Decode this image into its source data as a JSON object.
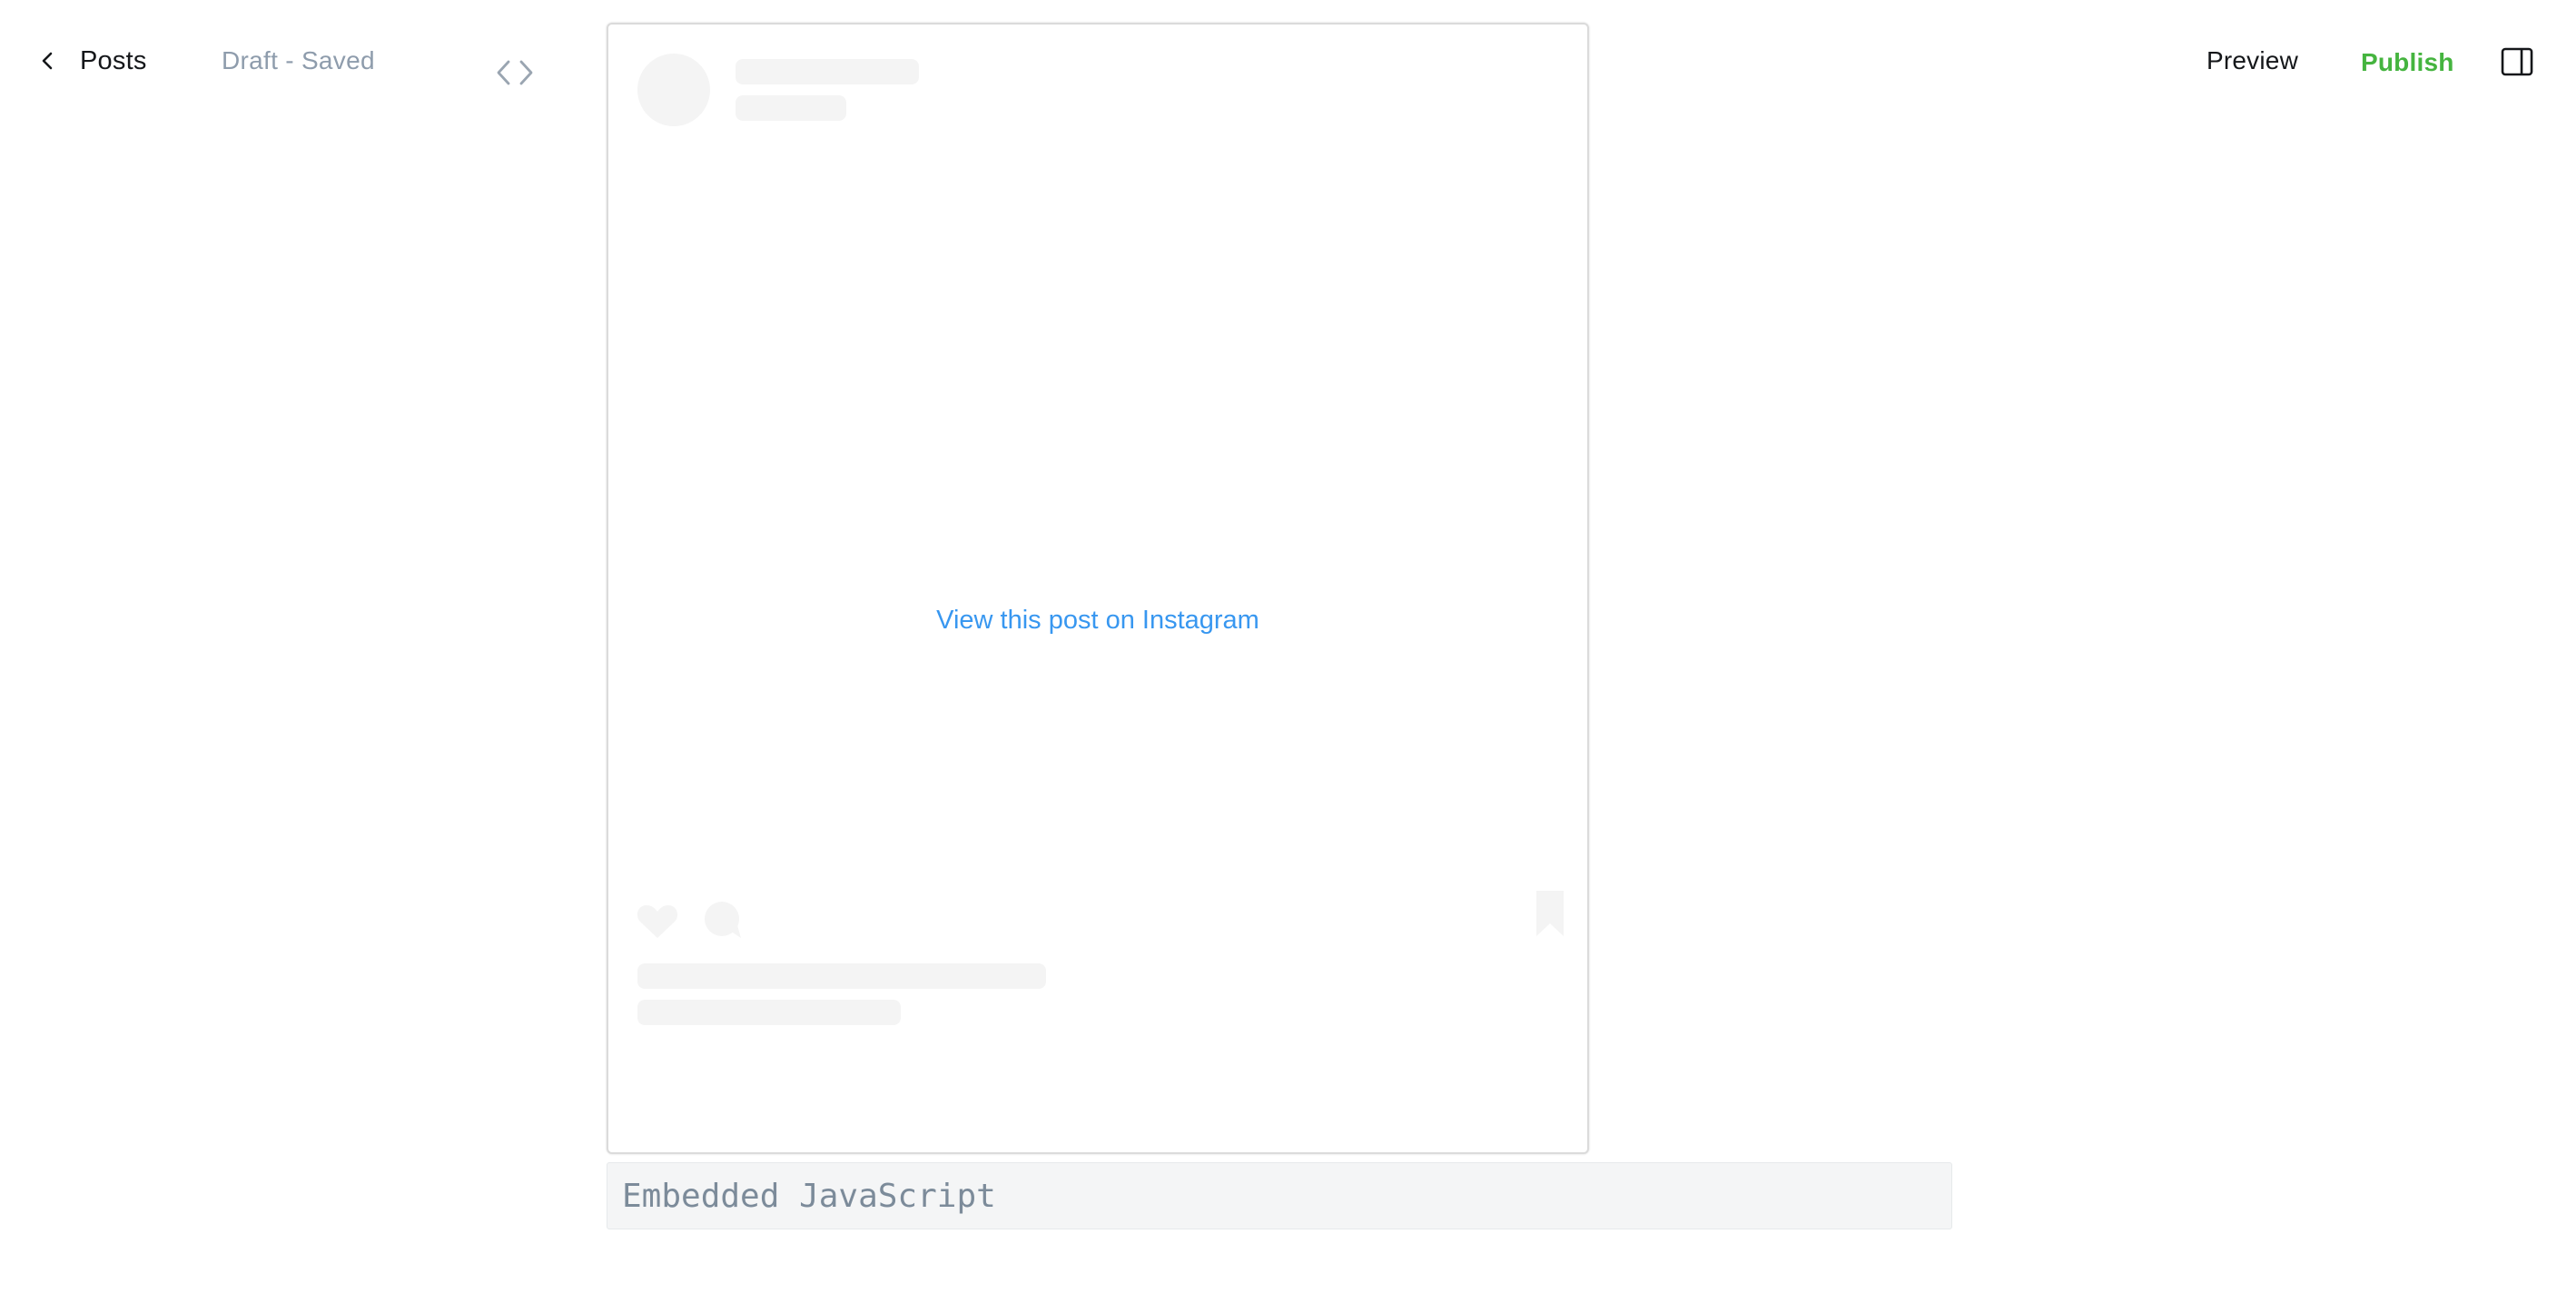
{
  "header": {
    "back_label": "Posts",
    "status": "Draft - Saved",
    "preview_label": "Preview",
    "publish_label": "Publish"
  },
  "embed": {
    "link_text": "View this post on Instagram"
  },
  "code_block": {
    "placeholder": "Embedded JavaScript"
  },
  "colors": {
    "publish": "#45b43f",
    "link": "#3897f0",
    "placeholder_fill": "#f4f4f4",
    "muted_text": "#8e9cac"
  },
  "icons": {
    "back": "chevron-left-icon",
    "html": "code-brackets-icon",
    "sidebar": "sidebar-panel-icon",
    "like": "heart-icon",
    "comment": "comment-bubble-icon",
    "save": "bookmark-icon"
  }
}
